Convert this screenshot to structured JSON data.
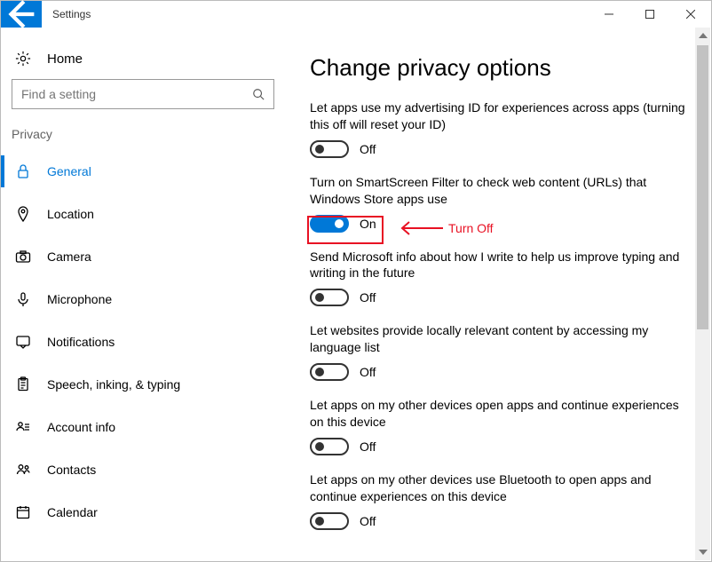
{
  "titlebar": {
    "title": "Settings"
  },
  "sidebar": {
    "home_label": "Home",
    "search_placeholder": "Find a setting",
    "category_label": "Privacy",
    "items": [
      {
        "label": "General",
        "selected": true
      },
      {
        "label": "Location",
        "selected": false
      },
      {
        "label": "Camera",
        "selected": false
      },
      {
        "label": "Microphone",
        "selected": false
      },
      {
        "label": "Notifications",
        "selected": false
      },
      {
        "label": "Speech, inking, & typing",
        "selected": false
      },
      {
        "label": "Account info",
        "selected": false
      },
      {
        "label": "Contacts",
        "selected": false
      },
      {
        "label": "Calendar",
        "selected": false
      }
    ]
  },
  "main": {
    "title": "Change privacy options",
    "settings": [
      {
        "label": "Let apps use my advertising ID for experiences across apps (turning this off will reset your ID)",
        "on": false,
        "state_label": "Off"
      },
      {
        "label": "Turn on SmartScreen Filter to check web content (URLs) that Windows Store apps use",
        "on": true,
        "state_label": "On"
      },
      {
        "label": "Send Microsoft info about how I write to help us improve typing and writing in the future",
        "on": false,
        "state_label": "Off"
      },
      {
        "label": "Let websites provide locally relevant content by accessing my language list",
        "on": false,
        "state_label": "Off"
      },
      {
        "label": "Let apps on my other devices open apps and continue experiences on this device",
        "on": false,
        "state_label": "Off"
      },
      {
        "label": "Let apps on my other devices use Bluetooth to open apps and continue experiences on this device",
        "on": false,
        "state_label": "Off"
      }
    ]
  },
  "annotation": {
    "text": "Turn Off"
  }
}
